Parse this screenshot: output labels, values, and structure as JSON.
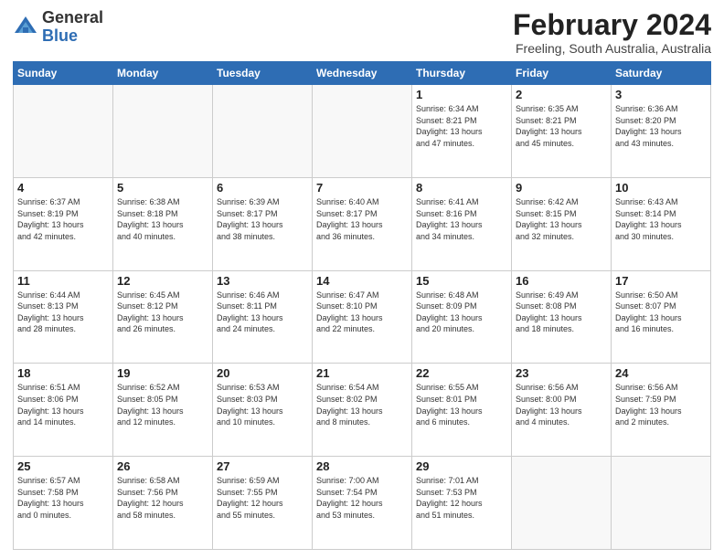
{
  "header": {
    "logo_general": "General",
    "logo_blue": "Blue",
    "month_title": "February 2024",
    "location": "Freeling, South Australia, Australia"
  },
  "weekdays": [
    "Sunday",
    "Monday",
    "Tuesday",
    "Wednesday",
    "Thursday",
    "Friday",
    "Saturday"
  ],
  "weeks": [
    [
      {
        "day": "",
        "info": ""
      },
      {
        "day": "",
        "info": ""
      },
      {
        "day": "",
        "info": ""
      },
      {
        "day": "",
        "info": ""
      },
      {
        "day": "1",
        "info": "Sunrise: 6:34 AM\nSunset: 8:21 PM\nDaylight: 13 hours\nand 47 minutes."
      },
      {
        "day": "2",
        "info": "Sunrise: 6:35 AM\nSunset: 8:21 PM\nDaylight: 13 hours\nand 45 minutes."
      },
      {
        "day": "3",
        "info": "Sunrise: 6:36 AM\nSunset: 8:20 PM\nDaylight: 13 hours\nand 43 minutes."
      }
    ],
    [
      {
        "day": "4",
        "info": "Sunrise: 6:37 AM\nSunset: 8:19 PM\nDaylight: 13 hours\nand 42 minutes."
      },
      {
        "day": "5",
        "info": "Sunrise: 6:38 AM\nSunset: 8:18 PM\nDaylight: 13 hours\nand 40 minutes."
      },
      {
        "day": "6",
        "info": "Sunrise: 6:39 AM\nSunset: 8:17 PM\nDaylight: 13 hours\nand 38 minutes."
      },
      {
        "day": "7",
        "info": "Sunrise: 6:40 AM\nSunset: 8:17 PM\nDaylight: 13 hours\nand 36 minutes."
      },
      {
        "day": "8",
        "info": "Sunrise: 6:41 AM\nSunset: 8:16 PM\nDaylight: 13 hours\nand 34 minutes."
      },
      {
        "day": "9",
        "info": "Sunrise: 6:42 AM\nSunset: 8:15 PM\nDaylight: 13 hours\nand 32 minutes."
      },
      {
        "day": "10",
        "info": "Sunrise: 6:43 AM\nSunset: 8:14 PM\nDaylight: 13 hours\nand 30 minutes."
      }
    ],
    [
      {
        "day": "11",
        "info": "Sunrise: 6:44 AM\nSunset: 8:13 PM\nDaylight: 13 hours\nand 28 minutes."
      },
      {
        "day": "12",
        "info": "Sunrise: 6:45 AM\nSunset: 8:12 PM\nDaylight: 13 hours\nand 26 minutes."
      },
      {
        "day": "13",
        "info": "Sunrise: 6:46 AM\nSunset: 8:11 PM\nDaylight: 13 hours\nand 24 minutes."
      },
      {
        "day": "14",
        "info": "Sunrise: 6:47 AM\nSunset: 8:10 PM\nDaylight: 13 hours\nand 22 minutes."
      },
      {
        "day": "15",
        "info": "Sunrise: 6:48 AM\nSunset: 8:09 PM\nDaylight: 13 hours\nand 20 minutes."
      },
      {
        "day": "16",
        "info": "Sunrise: 6:49 AM\nSunset: 8:08 PM\nDaylight: 13 hours\nand 18 minutes."
      },
      {
        "day": "17",
        "info": "Sunrise: 6:50 AM\nSunset: 8:07 PM\nDaylight: 13 hours\nand 16 minutes."
      }
    ],
    [
      {
        "day": "18",
        "info": "Sunrise: 6:51 AM\nSunset: 8:06 PM\nDaylight: 13 hours\nand 14 minutes."
      },
      {
        "day": "19",
        "info": "Sunrise: 6:52 AM\nSunset: 8:05 PM\nDaylight: 13 hours\nand 12 minutes."
      },
      {
        "day": "20",
        "info": "Sunrise: 6:53 AM\nSunset: 8:03 PM\nDaylight: 13 hours\nand 10 minutes."
      },
      {
        "day": "21",
        "info": "Sunrise: 6:54 AM\nSunset: 8:02 PM\nDaylight: 13 hours\nand 8 minutes."
      },
      {
        "day": "22",
        "info": "Sunrise: 6:55 AM\nSunset: 8:01 PM\nDaylight: 13 hours\nand 6 minutes."
      },
      {
        "day": "23",
        "info": "Sunrise: 6:56 AM\nSunset: 8:00 PM\nDaylight: 13 hours\nand 4 minutes."
      },
      {
        "day": "24",
        "info": "Sunrise: 6:56 AM\nSunset: 7:59 PM\nDaylight: 13 hours\nand 2 minutes."
      }
    ],
    [
      {
        "day": "25",
        "info": "Sunrise: 6:57 AM\nSunset: 7:58 PM\nDaylight: 13 hours\nand 0 minutes."
      },
      {
        "day": "26",
        "info": "Sunrise: 6:58 AM\nSunset: 7:56 PM\nDaylight: 12 hours\nand 58 minutes."
      },
      {
        "day": "27",
        "info": "Sunrise: 6:59 AM\nSunset: 7:55 PM\nDaylight: 12 hours\nand 55 minutes."
      },
      {
        "day": "28",
        "info": "Sunrise: 7:00 AM\nSunset: 7:54 PM\nDaylight: 12 hours\nand 53 minutes."
      },
      {
        "day": "29",
        "info": "Sunrise: 7:01 AM\nSunset: 7:53 PM\nDaylight: 12 hours\nand 51 minutes."
      },
      {
        "day": "",
        "info": ""
      },
      {
        "day": "",
        "info": ""
      }
    ]
  ]
}
